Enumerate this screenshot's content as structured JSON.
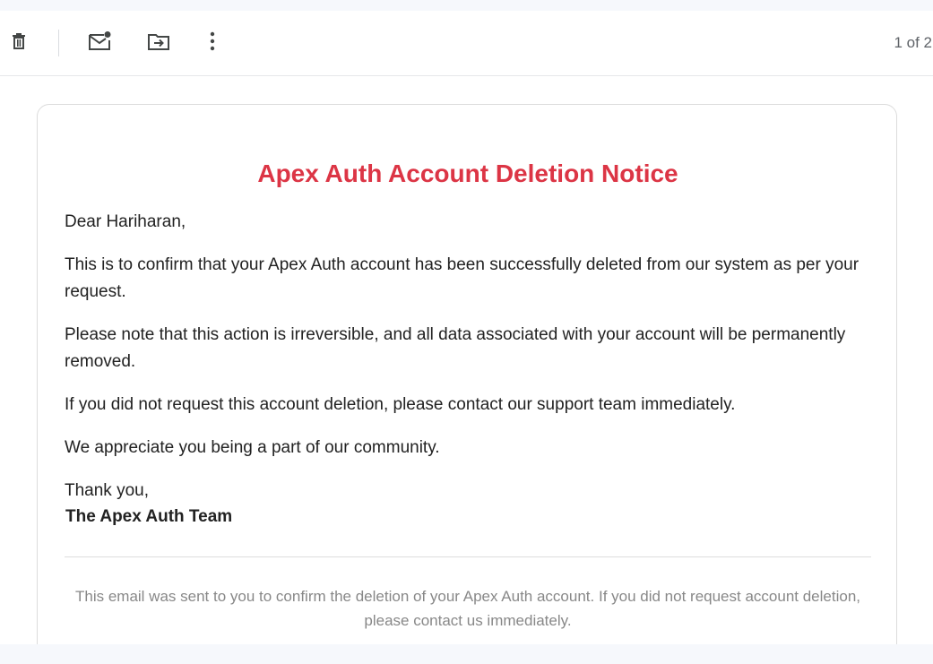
{
  "toolbar": {
    "icons": [
      "delete-icon",
      "mark-unread-icon",
      "move-to-icon",
      "more-options-icon"
    ],
    "pager": "1 of 2"
  },
  "email": {
    "title": "Apex Auth Account Deletion Notice",
    "greeting": "Dear Hariharan,",
    "paragraphs": [
      "This is to confirm that your Apex Auth account has been successfully deleted from our system as per your request.",
      "Please note that this action is irreversible, and all data associated with your account will be permanently removed.",
      "If you did not request this account deletion, please contact our support team immediately.",
      "We appreciate you being a part of our community."
    ],
    "signoff": "Thank you,",
    "team": "The Apex Auth Team",
    "footer": "This email was sent to you to confirm the deletion of your Apex Auth account. If you did not request account deletion, please contact us immediately."
  },
  "colors": {
    "title": "#dc3545",
    "body_text": "#222222",
    "footer_text": "#888888",
    "toolbar_icon": "#444746"
  }
}
